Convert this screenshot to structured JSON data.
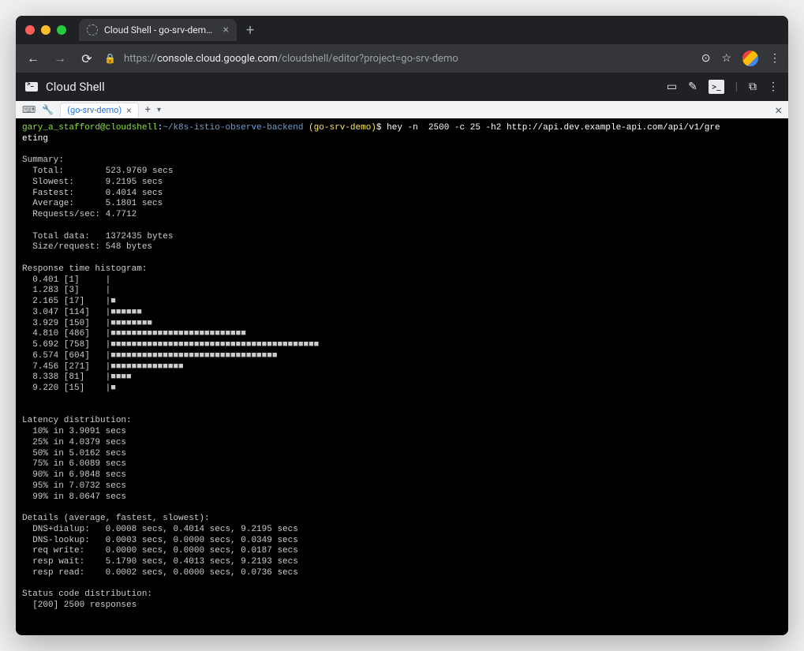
{
  "browser": {
    "tab_title": "Cloud Shell - go-srv-demo - G",
    "url_scheme": "https://",
    "url_host": "console.cloud.google.com",
    "url_path": "/cloudshell/editor?project=go-srv-demo"
  },
  "app": {
    "title": "Cloud Shell"
  },
  "tabstrip": {
    "tab_label": "(go-srv-demo)"
  },
  "terminal": {
    "prompt_user": "gary_a_stafford@cloudshell",
    "prompt_sep": ":",
    "prompt_path": "~/k8s-istio-observe-backend",
    "prompt_project": " (go-srv-demo)",
    "prompt_dollar": "$",
    "command": " hey -n  2500 -c 25 -h2 http://api.dev.example-api.com/api/v1/gre\neting",
    "summary_header": "Summary:",
    "summary": [
      "  Total:\t523.9769 secs",
      "  Slowest:\t9.2195 secs",
      "  Fastest:\t0.4014 secs",
      "  Average:\t5.1801 secs",
      "  Requests/sec:\t4.7712",
      "",
      "  Total data:\t1372435 bytes",
      "  Size/request:\t548 bytes"
    ],
    "histogram_header": "Response time histogram:",
    "histogram": [
      "  0.401 [1]\t|",
      "  1.283 [3]\t|",
      "  2.165 [17]\t|■",
      "  3.047 [114]\t|■■■■■■",
      "  3.929 [150]\t|■■■■■■■■",
      "  4.810 [486]\t|■■■■■■■■■■■■■■■■■■■■■■■■■■",
      "  5.692 [758]\t|■■■■■■■■■■■■■■■■■■■■■■■■■■■■■■■■■■■■■■■■",
      "  6.574 [604]\t|■■■■■■■■■■■■■■■■■■■■■■■■■■■■■■■■",
      "  7.456 [271]\t|■■■■■■■■■■■■■■",
      "  8.338 [81]\t|■■■■",
      "  9.220 [15]\t|■"
    ],
    "latency_header": "Latency distribution:",
    "latency": [
      "  10% in 3.9091 secs",
      "  25% in 4.0379 secs",
      "  50% in 5.0162 secs",
      "  75% in 6.0089 secs",
      "  90% in 6.9848 secs",
      "  95% in 7.0732 secs",
      "  99% in 8.0647 secs"
    ],
    "details_header": "Details (average, fastest, slowest):",
    "details": [
      "  DNS+dialup:\t0.0008 secs, 0.4014 secs, 9.2195 secs",
      "  DNS-lookup:\t0.0003 secs, 0.0000 secs, 0.0349 secs",
      "  req write:\t0.0000 secs, 0.0000 secs, 0.0187 secs",
      "  resp wait:\t5.1790 secs, 0.4013 secs, 9.2193 secs",
      "  resp read:\t0.0002 secs, 0.0000 secs, 0.0736 secs"
    ],
    "status_header": "Status code distribution:",
    "status_line": "  [200] 2500 responses"
  }
}
